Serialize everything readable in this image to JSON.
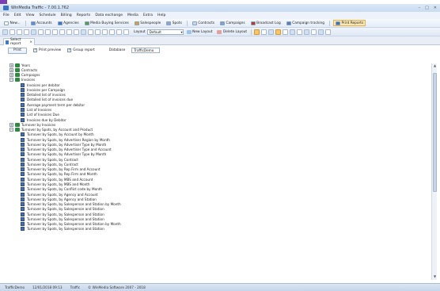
{
  "window": {
    "title": "WinMedia Traffic - 7.00.1.762",
    "controls": [
      "–",
      "□",
      "✕"
    ]
  },
  "menu": [
    "File",
    "Edit",
    "View",
    "Schedule",
    "Billing",
    "Reports",
    "Data exchange",
    "Media",
    "Extra",
    "Help"
  ],
  "toolbar1": [
    {
      "label": "New...",
      "icon": "new-icon",
      "color": "#ffffff"
    },
    {
      "label": "Accounts",
      "icon": "accounts-icon",
      "color": "#5b8fd4"
    },
    {
      "label": "Agencies",
      "icon": "agencies-icon",
      "color": "#3f76c6"
    },
    {
      "label": "Media Buying Services",
      "icon": "media-buying-icon",
      "color": "#5a9b4b"
    },
    {
      "label": "Salespeople",
      "icon": "salespeople-icon",
      "color": "#d9a236"
    },
    {
      "label": "Spots",
      "icon": "spots-icon",
      "color": "#8aa7cd"
    },
    {
      "label": "Contracts",
      "icon": "contracts-icon",
      "color": "#c9d6e8"
    },
    {
      "label": "Campaigns",
      "icon": "campaigns-icon",
      "color": "#7aa2d2"
    },
    {
      "label": "Broadcast Log",
      "icon": "broadcast-log-icon",
      "color": "#b9372f"
    },
    {
      "label": "Campaign tracking",
      "icon": "campaign-tracking-icon",
      "color": "#5680b8"
    },
    {
      "label": "Print Reports",
      "icon": "print-reports-icon",
      "color": "#4a6ea8",
      "active": true
    }
  ],
  "toolbar2": {
    "layout_label": "Layout",
    "layout_value": "Default",
    "new_layout": "New Layout",
    "delete_layout": "Delete Layout"
  },
  "tab": {
    "label": "Select report"
  },
  "options": {
    "print_button": "Print",
    "print_preview": "Print preview",
    "group_report": "Group report",
    "database_label": "Database",
    "database_value": "TrafficDemo"
  },
  "tree": [
    {
      "level": 0,
      "type": "folder",
      "expander": "+",
      "label": "Years"
    },
    {
      "level": 0,
      "type": "folder",
      "expander": "+",
      "label": "Contracts"
    },
    {
      "level": 0,
      "type": "folder",
      "expander": "+",
      "label": "Campaigns"
    },
    {
      "level": 0,
      "type": "folder",
      "expander": "−",
      "label": "Invoices"
    },
    {
      "level": 1,
      "type": "report",
      "label": "Invoices per debitor"
    },
    {
      "level": 1,
      "type": "report",
      "label": "Invoices per Campaign"
    },
    {
      "level": 1,
      "type": "report",
      "label": "Detailed list of invoices"
    },
    {
      "level": 1,
      "type": "report",
      "label": "Detailed list of invoices due"
    },
    {
      "level": 1,
      "type": "report",
      "label": "Average payment term per debitor"
    },
    {
      "level": 1,
      "type": "report",
      "label": "List of Invoices"
    },
    {
      "level": 1,
      "type": "report",
      "label": "List of Invoices Due"
    },
    {
      "level": 1,
      "type": "report",
      "label": "Invoices due by Debitor"
    },
    {
      "level": 0,
      "type": "folder",
      "expander": "+",
      "label": "Turnover by Invoices"
    },
    {
      "level": 0,
      "type": "folder",
      "expander": "−",
      "label": "Turnover by Spots, by Account and Product"
    },
    {
      "level": 1,
      "type": "report",
      "label": "Turnover by Spots, by Account by Month"
    },
    {
      "level": 1,
      "type": "report",
      "label": "Turnover by Spots, by Advertiser Region by Month"
    },
    {
      "level": 1,
      "type": "report",
      "label": "Turnover by Spots, by Advertiser Type by Month"
    },
    {
      "level": 1,
      "type": "report",
      "label": "Turnover by Spots, by Advertiser Type and Account"
    },
    {
      "level": 1,
      "type": "report",
      "label": "Turnover by Spots, by Advertiser Type by Month"
    },
    {
      "level": 1,
      "type": "report",
      "label": "Turnover by Spots, by Contract"
    },
    {
      "level": 1,
      "type": "report",
      "label": "Turnover by Spots, by Contract"
    },
    {
      "level": 1,
      "type": "report",
      "label": "Turnover by Spots, by Rep Firm and Account"
    },
    {
      "level": 1,
      "type": "report",
      "label": "Turnover by Spots, by Rep Firm and Month"
    },
    {
      "level": 1,
      "type": "report",
      "label": "Turnover by Spots, by MBS and Account"
    },
    {
      "level": 1,
      "type": "report",
      "label": "Turnover by Spots, by MBS and Month"
    },
    {
      "level": 1,
      "type": "report",
      "label": "Turnover by Spots, by Conflict code by Month"
    },
    {
      "level": 1,
      "type": "report",
      "label": "Turnover by Spots, by Agency and Account"
    },
    {
      "level": 1,
      "type": "report",
      "label": "Turnover by Spots, by Agency and Station"
    },
    {
      "level": 1,
      "type": "report",
      "label": "Turnover by Spots, by Salesperson and Station by Month"
    },
    {
      "level": 1,
      "type": "report",
      "label": "Turnover by Spots, by Salesperson and Station"
    },
    {
      "level": 1,
      "type": "report",
      "label": "Turnover by Spots, by Salesperson and Station"
    },
    {
      "level": 1,
      "type": "report",
      "label": "Turnover by Spots, by Salesperson and Station"
    },
    {
      "level": 1,
      "type": "report",
      "label": "Turnover by Spots, by Salesperson and Station by Month"
    },
    {
      "level": 1,
      "type": "report",
      "label": "Turnover by Spots, by Salesperson and Station"
    }
  ],
  "status": {
    "user": "TrafficDemo",
    "datetime": "12/01/2018 09:13",
    "module": "Traffic",
    "copyright": "© WinMedia Software 2007 - 2018"
  }
}
